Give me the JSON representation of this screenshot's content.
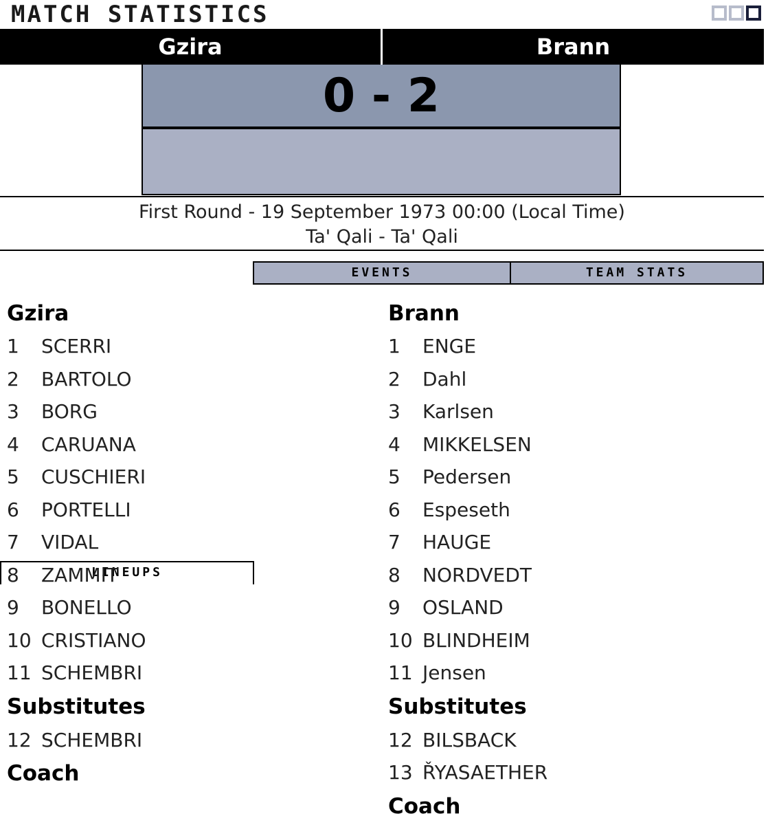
{
  "app_title": "MATCH STATISTICS",
  "window_controls": [
    "restore-icon",
    "maximize-icon",
    "close-icon"
  ],
  "match": {
    "home_team": "Gzira",
    "away_team": "Brann",
    "score": "0 - 2",
    "round_date": "First Round - 19 September 1973 00:00 (Local Time)",
    "venue": "Ta' Qali - Ta' Qali"
  },
  "tabs": [
    "LINEUPS",
    "EVENTS",
    "TEAM STATS"
  ],
  "active_tab": "LINEUPS",
  "home": {
    "name": "Gzira",
    "players": [
      {
        "num": "1",
        "name": "SCERRI"
      },
      {
        "num": "2",
        "name": "BARTOLO"
      },
      {
        "num": "3",
        "name": "BORG"
      },
      {
        "num": "4",
        "name": "CARUANA"
      },
      {
        "num": "5",
        "name": "CUSCHIERI"
      },
      {
        "num": "6",
        "name": "PORTELLI"
      },
      {
        "num": "7",
        "name": "VIDAL"
      },
      {
        "num": "8",
        "name": "ZAMMIT"
      },
      {
        "num": "9",
        "name": "BONELLO"
      },
      {
        "num": "10",
        "name": "CRISTIANO"
      },
      {
        "num": "11",
        "name": "SCHEMBRI"
      }
    ],
    "substitutes_label": "Substitutes",
    "substitutes": [
      {
        "num": "12",
        "name": "SCHEMBRI"
      }
    ],
    "coach_label": "Coach"
  },
  "away": {
    "name": "Brann",
    "players": [
      {
        "num": "1",
        "name": "ENGE"
      },
      {
        "num": "2",
        "name": "Dahl"
      },
      {
        "num": "3",
        "name": "Karlsen"
      },
      {
        "num": "4",
        "name": "MIKKELSEN"
      },
      {
        "num": "5",
        "name": "Pedersen"
      },
      {
        "num": "6",
        "name": "Espeseth"
      },
      {
        "num": "7",
        "name": "HAUGE"
      },
      {
        "num": "8",
        "name": "NORDVEDT"
      },
      {
        "num": "9",
        "name": "OSLAND"
      },
      {
        "num": "10",
        "name": "BLINDHEIM"
      },
      {
        "num": "11",
        "name": "Jensen"
      }
    ],
    "substitutes_label": "Substitutes",
    "substitutes": [
      {
        "num": "12",
        "name": "BILSBACK"
      },
      {
        "num": "13",
        "name": "ŘYASAETHER"
      }
    ],
    "coach_label": "Coach"
  }
}
